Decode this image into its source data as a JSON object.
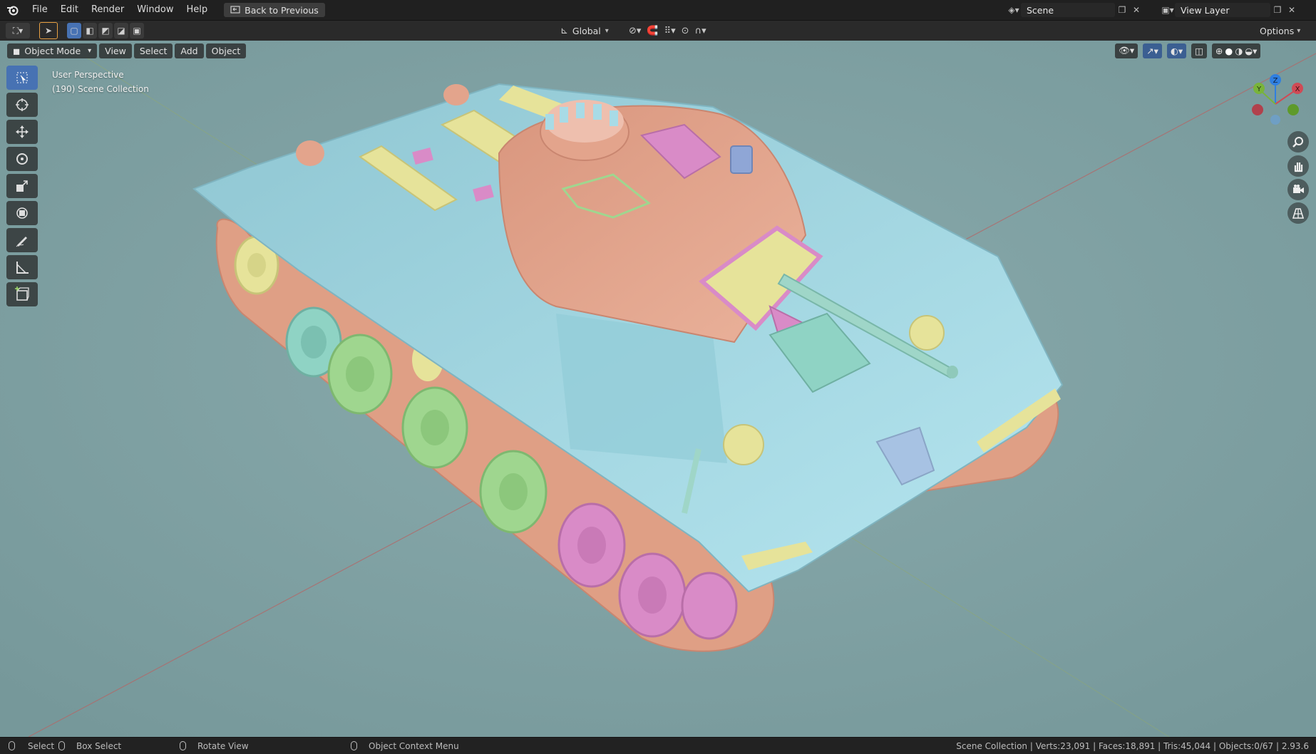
{
  "menu": {
    "items": [
      "File",
      "Edit",
      "Render",
      "Window",
      "Help"
    ],
    "back_label": "Back to Previous"
  },
  "scene": {
    "name": "Scene",
    "view_layer": "View Layer"
  },
  "header": {
    "orientation": "Global",
    "options_label": "Options"
  },
  "viewport_header": {
    "mode": "Object Mode",
    "view": "View",
    "select": "Select",
    "add": "Add",
    "object": "Object"
  },
  "overlay": {
    "perspective": "User Perspective",
    "collection": "(190) Scene Collection"
  },
  "gizmo": {
    "x": "X",
    "y": "Y",
    "z": "Z"
  },
  "status": {
    "select": "Select",
    "box_select": "Box Select",
    "rotate_view": "Rotate View",
    "context_menu": "Object Context Menu",
    "stats": "Scene Collection | Verts:23,091 | Faces:18,891 | Tris:45,044 | Objects:0/67 | 2.93.6"
  },
  "colors": {
    "viewport_bg": "#7fa1a3",
    "hull": "#a8dbe6",
    "turret": "#e3a48c",
    "track": "#df9f85",
    "accent_yellow": "#e6e39a",
    "wheel_green": "#9fd68f",
    "wheel_pink": "#d98bc7",
    "active_tool": "#4772b3"
  }
}
